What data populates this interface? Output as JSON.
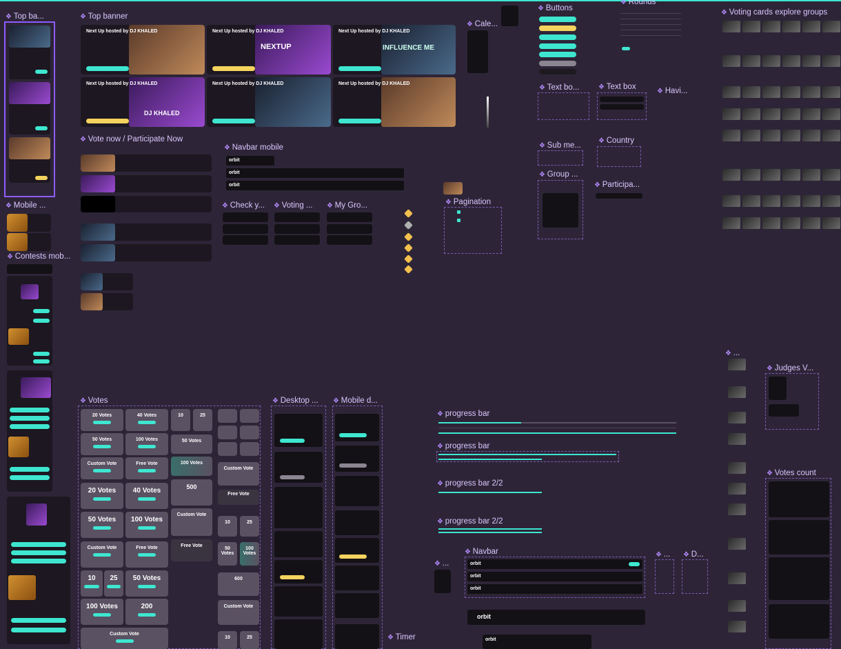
{
  "sections": {
    "top_banner_mobile": "Top ba...",
    "top_banner": "Top banner",
    "calendar": "Cale...",
    "buttons": "Buttons",
    "rounds": "Rounds",
    "voting_cards": "Voting cards explore groups",
    "vote_now": "Vote now / Participate Now",
    "navbar_mobile": "Navbar mobile",
    "text_box_1": "Text bo...",
    "text_box_2": "Text box",
    "having": "Havi...",
    "sub_menu": "Sub me...",
    "country": "Country",
    "group": "Group ...",
    "participants": "Participa...",
    "pagination": "Pagination",
    "mobile": "Mobile ...",
    "contests_mobile": "Contests mob...",
    "check": "Check y...",
    "voting": "Voting ...",
    "my_group": "My Gro...",
    "votes": "Votes",
    "desktop": "Desktop ...",
    "mobile_d": "Mobile d...",
    "progress_bar_1": "progress bar",
    "progress_bar_2": "progress bar",
    "progress_bar_3": "progress bar 2/2",
    "progress_bar_4": "progress bar 2/2",
    "navbar": "Navbar",
    "timer": "Timer",
    "judges": "Judges V...",
    "votes_count": "Votes count",
    "dots_1": "...",
    "dots_2": "...",
    "d_section": "D..."
  },
  "banner": {
    "heading": "Next Up hosted by DJ KHALED",
    "nextup": "NEXTUP",
    "djkhaled": "DJ KHALED",
    "influenceme": "INFLUENCE ME"
  },
  "votes": {
    "v20": "20 Votes",
    "v40": "40 Votes",
    "v50": "50 Votes",
    "v100": "100 Votes",
    "custom": "Custom Vote",
    "free": "Free Vote",
    "v10": "10",
    "v25": "25",
    "v200": "200",
    "v500": "500",
    "v600": "600"
  },
  "navbar": {
    "logo": "orbit"
  },
  "colors": {
    "accent": "#3ee6d0",
    "bg": "#2d2537",
    "frame": "#8f5bff",
    "yellow": "#f4d35e"
  }
}
